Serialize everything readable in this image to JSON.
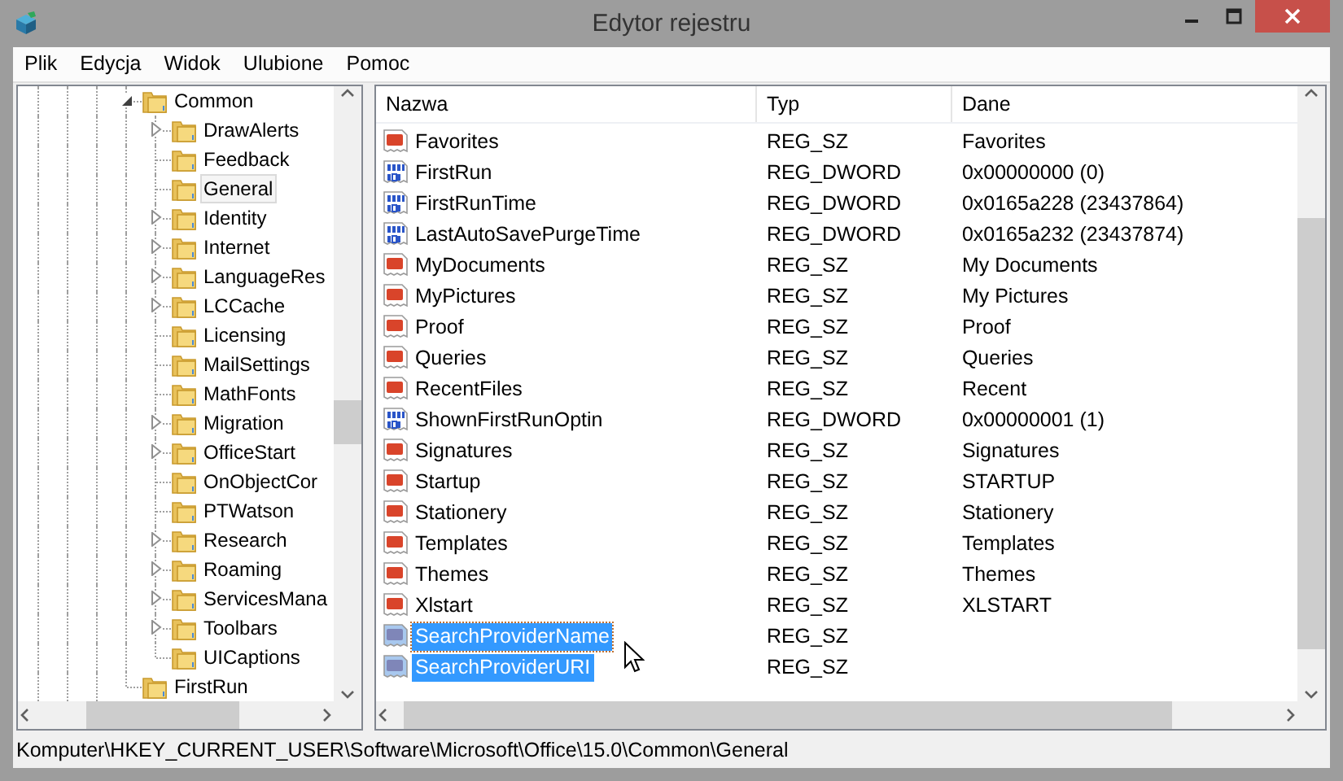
{
  "window": {
    "title": "Edytor rejestru"
  },
  "menu": [
    "Plik",
    "Edycja",
    "Widok",
    "Ulubione",
    "Pomoc"
  ],
  "tree": [
    {
      "label": "Common",
      "expanded": true,
      "selected": false,
      "children": [
        {
          "label": "DrawAlerts",
          "expandable": true,
          "selected": false
        },
        {
          "label": "Feedback",
          "expandable": false,
          "selected": false
        },
        {
          "label": "General",
          "expandable": false,
          "selected": true
        },
        {
          "label": "Identity",
          "expandable": true,
          "selected": false
        },
        {
          "label": "Internet",
          "expandable": true,
          "selected": false
        },
        {
          "label": "LanguageRes",
          "expandable": true,
          "selected": false
        },
        {
          "label": "LCCache",
          "expandable": true,
          "selected": false
        },
        {
          "label": "Licensing",
          "expandable": false,
          "selected": false
        },
        {
          "label": "MailSettings",
          "expandable": false,
          "selected": false
        },
        {
          "label": "MathFonts",
          "expandable": false,
          "selected": false
        },
        {
          "label": "Migration",
          "expandable": true,
          "selected": false
        },
        {
          "label": "OfficeStart",
          "expandable": true,
          "selected": false
        },
        {
          "label": "OnObjectCor",
          "expandable": false,
          "selected": false
        },
        {
          "label": "PTWatson",
          "expandable": false,
          "selected": false
        },
        {
          "label": "Research",
          "expandable": true,
          "selected": false
        },
        {
          "label": "Roaming",
          "expandable": true,
          "selected": false
        },
        {
          "label": "ServicesMana",
          "expandable": true,
          "selected": false
        },
        {
          "label": "Toolbars",
          "expandable": true,
          "selected": false
        },
        {
          "label": "UICaptions",
          "expandable": false,
          "selected": false
        }
      ]
    },
    {
      "label": "FirstRun",
      "expandable": false,
      "selected": false
    }
  ],
  "values": {
    "columns": [
      "Nazwa",
      "Typ",
      "Dane"
    ],
    "rows": [
      {
        "kind": "string",
        "name": "Favorites",
        "type": "REG_SZ",
        "data": "Favorites",
        "selected": false
      },
      {
        "kind": "dword",
        "name": "FirstRun",
        "type": "REG_DWORD",
        "data": "0x00000000 (0)",
        "selected": false
      },
      {
        "kind": "dword",
        "name": "FirstRunTime",
        "type": "REG_DWORD",
        "data": "0x0165a228 (23437864)",
        "selected": false
      },
      {
        "kind": "dword",
        "name": "LastAutoSavePurgeTime",
        "type": "REG_DWORD",
        "data": "0x0165a232 (23437874)",
        "selected": false
      },
      {
        "kind": "string",
        "name": "MyDocuments",
        "type": "REG_SZ",
        "data": "My Documents",
        "selected": false
      },
      {
        "kind": "string",
        "name": "MyPictures",
        "type": "REG_SZ",
        "data": "My Pictures",
        "selected": false
      },
      {
        "kind": "string",
        "name": "Proof",
        "type": "REG_SZ",
        "data": "Proof",
        "selected": false
      },
      {
        "kind": "string",
        "name": "Queries",
        "type": "REG_SZ",
        "data": "Queries",
        "selected": false
      },
      {
        "kind": "string",
        "name": "RecentFiles",
        "type": "REG_SZ",
        "data": "Recent",
        "selected": false
      },
      {
        "kind": "dword",
        "name": "ShownFirstRunOptin",
        "type": "REG_DWORD",
        "data": "0x00000001 (1)",
        "selected": false
      },
      {
        "kind": "string",
        "name": "Signatures",
        "type": "REG_SZ",
        "data": "Signatures",
        "selected": false
      },
      {
        "kind": "string",
        "name": "Startup",
        "type": "REG_SZ",
        "data": "STARTUP",
        "selected": false
      },
      {
        "kind": "string",
        "name": "Stationery",
        "type": "REG_SZ",
        "data": "Stationery",
        "selected": false
      },
      {
        "kind": "string",
        "name": "Templates",
        "type": "REG_SZ",
        "data": "Templates",
        "selected": false
      },
      {
        "kind": "string",
        "name": "Themes",
        "type": "REG_SZ",
        "data": "Themes",
        "selected": false
      },
      {
        "kind": "string",
        "name": "Xlstart",
        "type": "REG_SZ",
        "data": "XLSTART",
        "selected": false
      },
      {
        "kind": "string",
        "name": "SearchProviderName",
        "type": "REG_SZ",
        "selected": true
      },
      {
        "kind": "string",
        "name": "SearchProviderURI",
        "type": "REG_SZ",
        "selected": true
      }
    ]
  },
  "status_bar": "Komputer\\HKEY_CURRENT_USER\\Software\\Microsoft\\Office\\15.0\\Common\\General"
}
